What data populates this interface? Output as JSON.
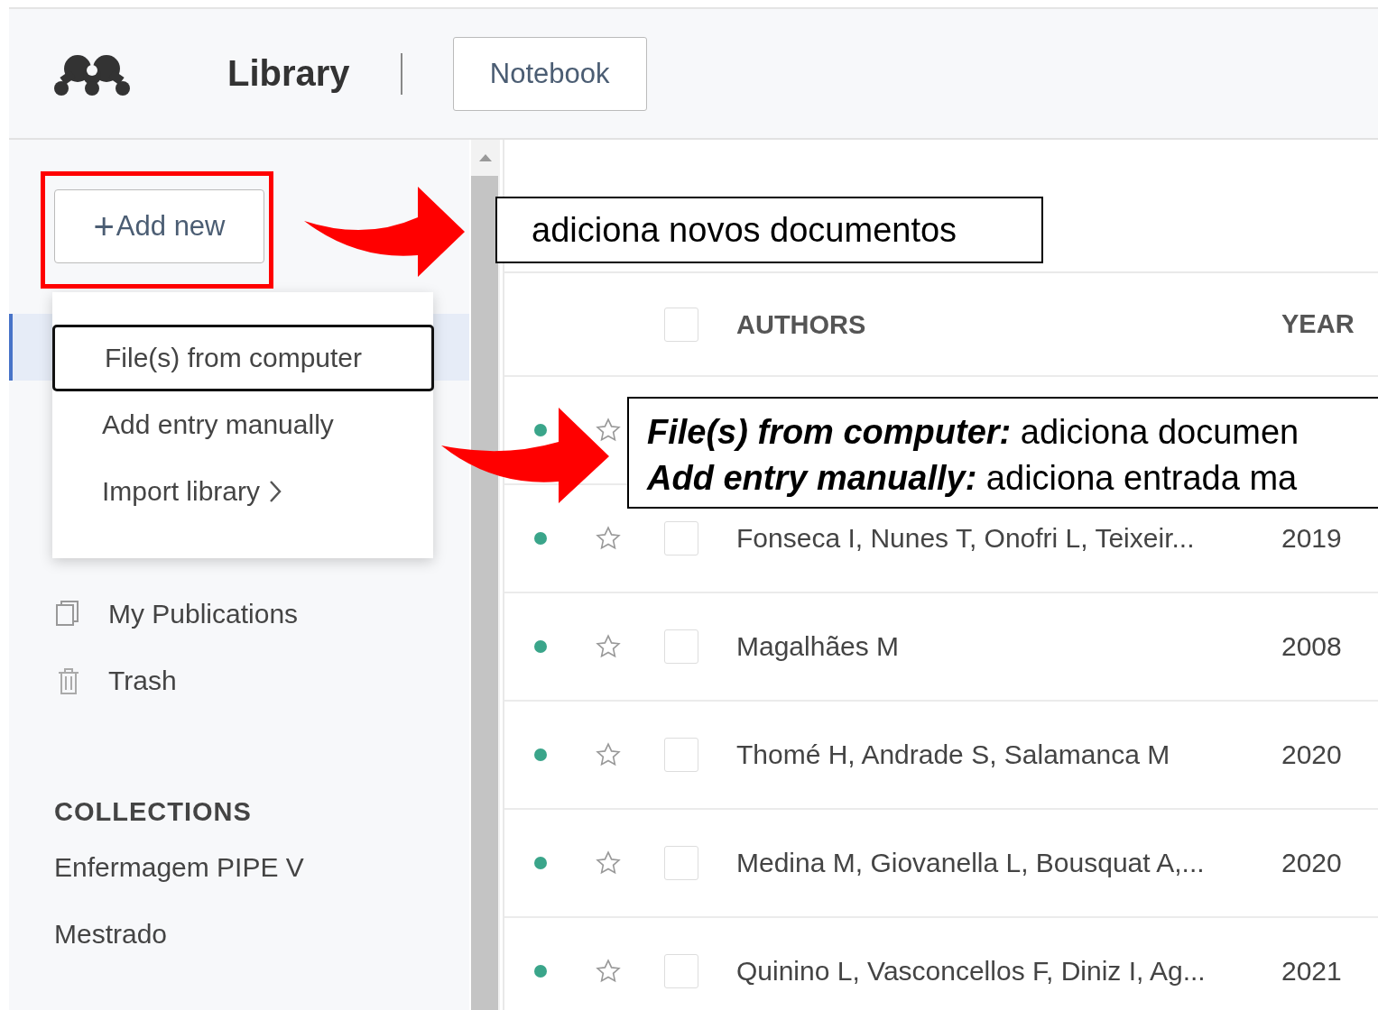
{
  "header": {
    "title": "Library",
    "tabs": [
      {
        "label": "Notebook"
      }
    ]
  },
  "sidebar": {
    "add_button": {
      "label": "Add new",
      "icon": "+"
    },
    "nav_items": [
      {
        "selected": true
      },
      {
        "selected": false
      },
      {
        "selected": false
      },
      {
        "selected": false
      },
      {
        "label": "My Publications",
        "kind": "publications",
        "selected": false
      },
      {
        "label": "Trash",
        "kind": "trash",
        "selected": false
      }
    ],
    "collections_heading": "COLLECTIONS",
    "collections": [
      {
        "label": "Enfermagem PIPE V"
      },
      {
        "label": "Mestrado"
      }
    ]
  },
  "add_menu": [
    {
      "label": "File(s) from computer",
      "selected": true,
      "submenu": false
    },
    {
      "label": "Add entry manually",
      "selected": false,
      "submenu": false
    },
    {
      "label": "Import library",
      "selected": false,
      "submenu": true
    }
  ],
  "table": {
    "columns": [
      "AUTHORS",
      "YEAR"
    ],
    "select_all_checked": false,
    "rows": [
      {
        "unread": true
      },
      {
        "unread": true,
        "checked": false,
        "authors": "Fonseca I, Nunes T, Onofri L, Teixeir...",
        "year": "2019"
      },
      {
        "unread": true,
        "checked": false,
        "authors": "Magalhães M",
        "year": "2008"
      },
      {
        "unread": true,
        "checked": false,
        "authors": "Thomé H, Andrade S, Salamanca M",
        "year": "2020"
      },
      {
        "unread": true,
        "checked": false,
        "authors": "Medina M, Giovanella L, Bousquat A,...",
        "year": "2020"
      },
      {
        "unread": true,
        "checked": false,
        "authors": "Quinino L, Vasconcellos F, Diniz I, Ag...",
        "year": "2021"
      }
    ]
  },
  "annotations": [
    {
      "kind": "callout",
      "text": "adiciona novos documentos"
    },
    {
      "kind": "legend",
      "lines": [
        {
          "term": "File(s) from computer:",
          "text": "adiciona documen"
        },
        {
          "term": "Add entry manually:",
          "text": "adiciona entrada ma"
        }
      ]
    }
  ]
}
